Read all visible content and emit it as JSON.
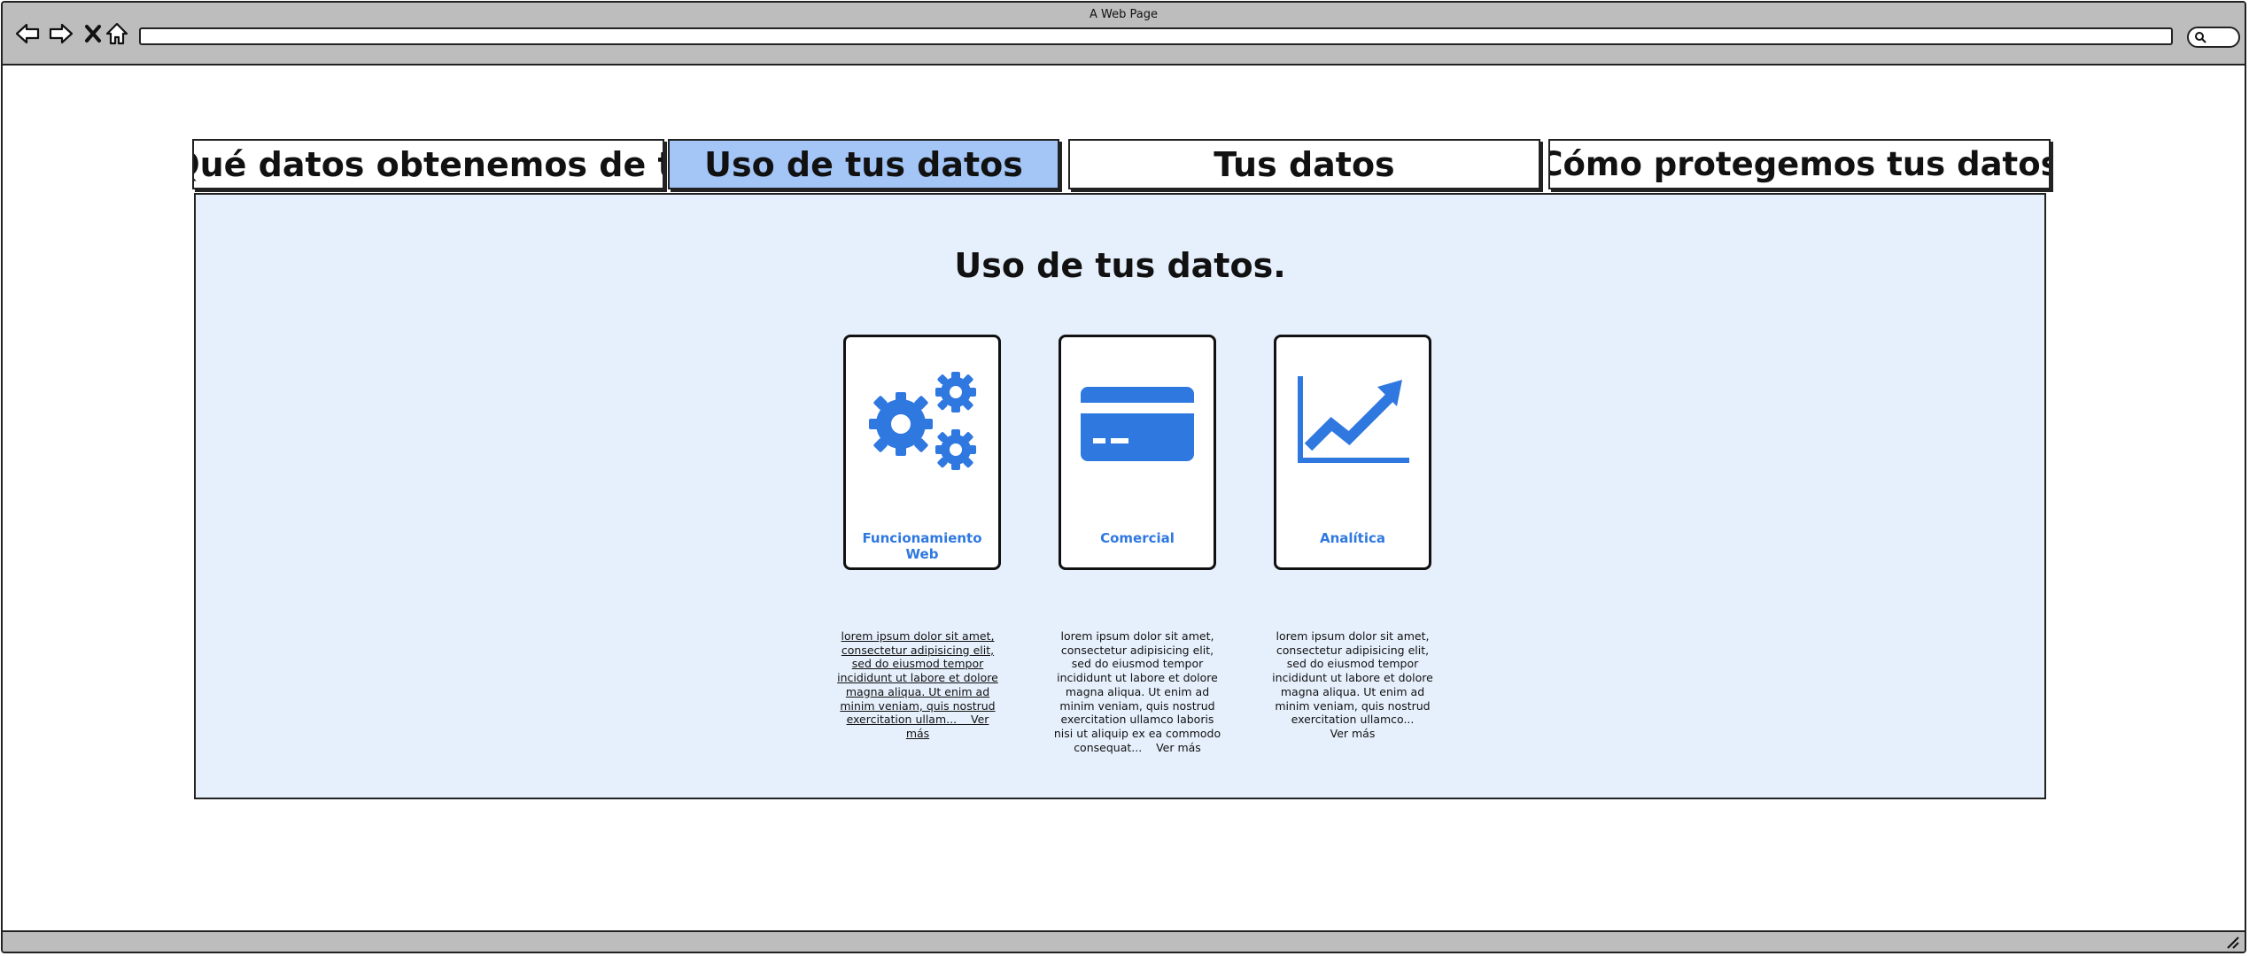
{
  "window": {
    "title": "A Web Page",
    "url": ""
  },
  "tabs": [
    {
      "label": "Qué datos obtenemos de ti",
      "active": false
    },
    {
      "label": "Uso de tus datos",
      "active": true
    },
    {
      "label": "Tus datos",
      "active": false
    },
    {
      "label": "¿Cómo protegemos tus datos?",
      "active": false
    }
  ],
  "panel": {
    "title": "Uso de tus datos.",
    "cards": [
      {
        "label": "Funcionamiento Web",
        "icon": "gears-icon",
        "description": "lorem ipsum dolor sit amet, consectetur adipisicing elit, sed do eiusmod tempor incididunt ut labore et dolore magna aliqua. Ut enim ad minim veniam, quis nostrud exercitation ullam...",
        "more": "Ver más"
      },
      {
        "label": "Comercial",
        "icon": "credit-card-icon",
        "description": "lorem ipsum dolor sit amet, consectetur adipisicing elit, sed do eiusmod tempor incididunt ut labore et dolore magna aliqua. Ut enim ad minim veniam, quis nostrud exercitation ullamco laboris nisi ut aliquip ex ea commodo consequat...",
        "more": "Ver más"
      },
      {
        "label": "Analítica",
        "icon": "trending-up-chart-icon",
        "description": "lorem ipsum dolor sit amet, consectetur adipisicing elit, sed do eiusmod tempor incididunt ut labore et dolore magna aliqua. Ut enim ad minim veniam, quis nostrud exercitation ullamco...",
        "more": "Ver más"
      }
    ]
  },
  "colors": {
    "accent": "#2f78e0",
    "active_tab": "#a4c6f7",
    "panel_bg": "#e6f0fc",
    "chrome": "#bdbdbd"
  }
}
